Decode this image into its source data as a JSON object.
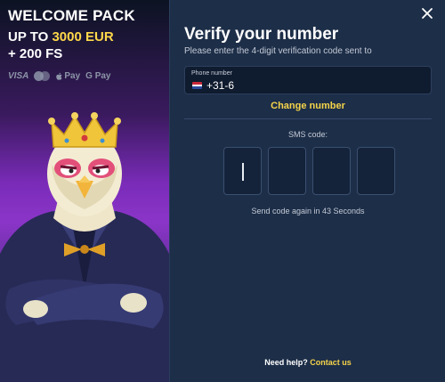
{
  "promo": {
    "title": "WELCOME PACK",
    "line2_prefix": "UP TO ",
    "line2_amount": "3000 EUR",
    "line3": "+ 200 FS",
    "payments": {
      "visa": "VISA",
      "apple_pay": "Pay",
      "google_pay": "G Pay"
    }
  },
  "verify": {
    "title": "Verify your number",
    "subtitle": "Please enter the 4-digit verification code sent to",
    "phone_label": "Phone number",
    "phone_value": "+31-6",
    "change_link": "Change number",
    "sms_label": "SMS code:",
    "otp_values": [
      "",
      "",
      "",
      ""
    ],
    "resend_text": "Send code again in 43 Seconds",
    "help_text": "Need help?",
    "help_link": "Contact us"
  },
  "colors": {
    "accent": "#f5d44a",
    "panel": "#1d2e48",
    "input": "#0f1b2e"
  }
}
